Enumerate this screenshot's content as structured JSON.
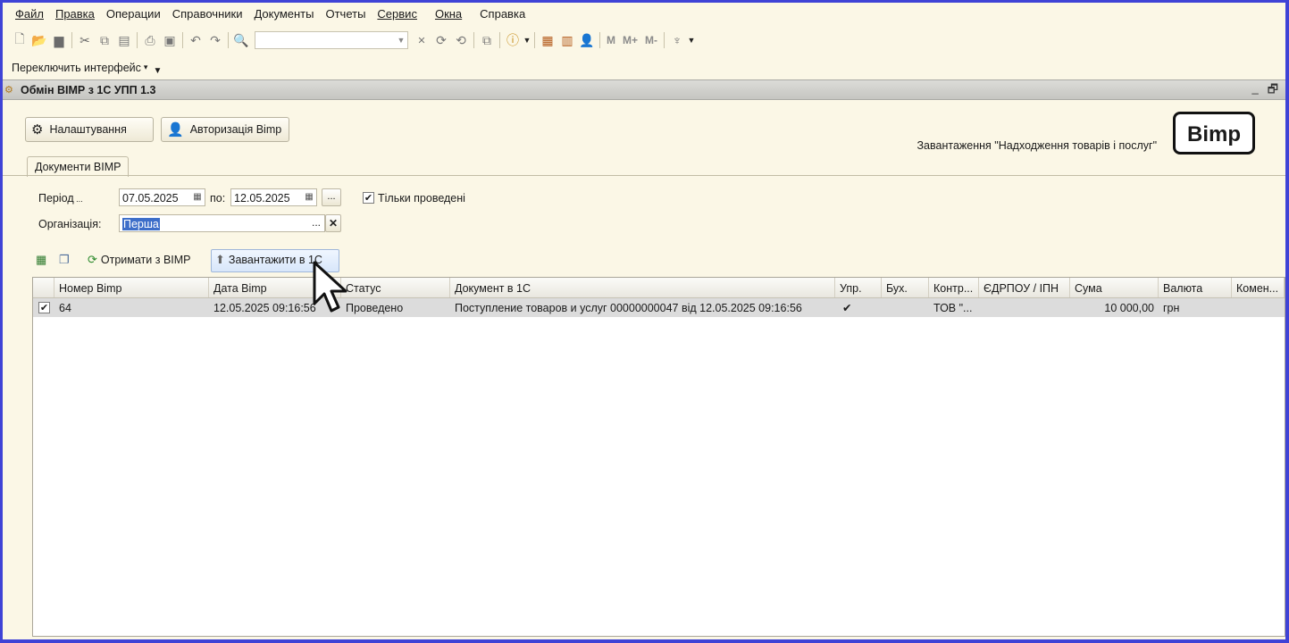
{
  "menu": [
    "Файл",
    "Правка",
    "Операции",
    "Справочники",
    "Документы",
    "Отчеты",
    "Сервис",
    "Окна",
    "Справка"
  ],
  "switch_interface": "Переключить интерфейс",
  "toolbar": {
    "m": "M",
    "mplus": "M+",
    "mminus": "M-"
  },
  "window": {
    "title": "Обмін ВІМР з 1С УПП 1.3"
  },
  "buttons": {
    "settings": "Налаштування",
    "auth": "Авторизація Bimp"
  },
  "logo": "Bimp",
  "upload_label": "Завантаження \"Надходження товарів і послуг\"",
  "tab": "Документи ВІМР",
  "filters": {
    "period_label": "Період",
    "date_from": "07.05.2025",
    "to_label": "по:",
    "date_to": "12.05.2025",
    "ellipsis": "...",
    "only_posted_label": "Тільки проведені",
    "only_posted": true,
    "org_label": "Організація:",
    "org_value": "Перша",
    "org_select": "...",
    "org_clear": "✕"
  },
  "actions": {
    "get": "Отримати з ВІМР",
    "load": "Завантажити в 1С"
  },
  "grid": {
    "columns": [
      "Номер Bimp",
      "Дата Bimp",
      "Статус",
      "Документ в 1С",
      "Упр.",
      "Бух.",
      "Контр...",
      "ЄДРПОУ / ІПН",
      "Сума",
      "Валюта",
      "Комен..."
    ],
    "rows": [
      {
        "checked": true,
        "number": "64",
        "date": "12.05.2025 09:16:56",
        "status": "Проведено",
        "doc": "Поступление товаров и услуг 00000000047 від 12.05.2025 09:16:56",
        "upr": "✔",
        "buh": "",
        "contr": "ТОВ \"...",
        "edrpou": "",
        "sum": "10 000,00",
        "currency": "грн",
        "comment": ""
      }
    ]
  }
}
